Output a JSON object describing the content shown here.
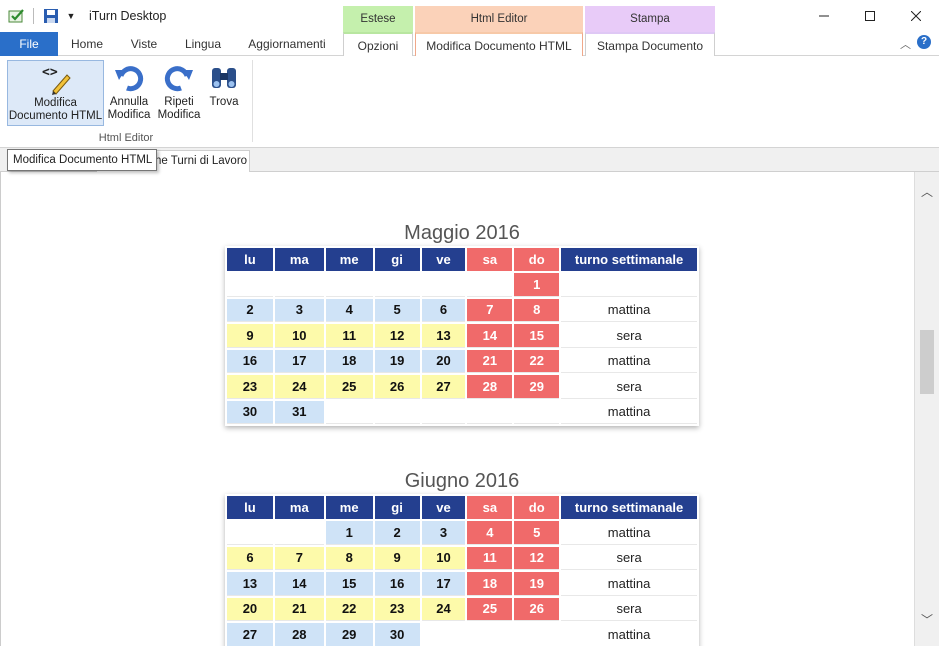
{
  "app": {
    "title": "iTurn Desktop"
  },
  "quick_access": {
    "icons": [
      "app-check-icon",
      "save-icon",
      "dropdown-icon"
    ]
  },
  "contextual": {
    "estese": "Estese",
    "html_editor": "Html Editor",
    "stampa": "Stampa"
  },
  "tabs": {
    "file": "File",
    "home": "Home",
    "viste": "Viste",
    "lingua": "Lingua",
    "aggiornamenti": "Aggiornamenti",
    "opzioni": "Opzioni",
    "modifica_doc": "Modifica Documento HTML",
    "stampa_doc": "Stampa Documento"
  },
  "ribbon": {
    "modifica_l1": "Modifica",
    "modifica_l2": "Documento HTML",
    "annulla_l1": "Annulla",
    "annulla_l2": "Modifica",
    "ripeti_l1": "Ripeti",
    "ripeti_l2": "Modifica",
    "trova": "Trova",
    "group_label": "Html Editor"
  },
  "tooltip": "Modifica Documento HTML",
  "doc_tab": "Generazione Turni di Lavoro",
  "doc_tab_visible": "ne Turni di Lavoro",
  "colors": {
    "header": "#243f8f",
    "weekend": "#f06a6a",
    "week_blue": "#cfe3f7",
    "week_yellow": "#fdfaaa",
    "file_tab": "#2a6fc9"
  },
  "calendar": {
    "headers": [
      "lu",
      "ma",
      "me",
      "gi",
      "ve",
      "sa",
      "do",
      "turno settimanale"
    ],
    "months": [
      {
        "title": "Maggio 2016",
        "rows": [
          {
            "days": [
              "",
              "",
              "",
              "",
              "",
              "",
              "1"
            ],
            "turno": "",
            "tint": "b"
          },
          {
            "days": [
              "2",
              "3",
              "4",
              "5",
              "6",
              "7",
              "8"
            ],
            "turno": "mattina",
            "tint": "b"
          },
          {
            "days": [
              "9",
              "10",
              "11",
              "12",
              "13",
              "14",
              "15"
            ],
            "turno": "sera",
            "tint": "y"
          },
          {
            "days": [
              "16",
              "17",
              "18",
              "19",
              "20",
              "21",
              "22"
            ],
            "turno": "mattina",
            "tint": "b"
          },
          {
            "days": [
              "23",
              "24",
              "25",
              "26",
              "27",
              "28",
              "29"
            ],
            "turno": "sera",
            "tint": "y"
          },
          {
            "days": [
              "30",
              "31",
              "",
              "",
              "",
              "",
              ""
            ],
            "turno": "mattina",
            "tint": "b"
          }
        ]
      },
      {
        "title": "Giugno 2016",
        "rows": [
          {
            "days": [
              "",
              "",
              "1",
              "2",
              "3",
              "4",
              "5"
            ],
            "turno": "mattina",
            "tint": "b"
          },
          {
            "days": [
              "6",
              "7",
              "8",
              "9",
              "10",
              "11",
              "12"
            ],
            "turno": "sera",
            "tint": "y"
          },
          {
            "days": [
              "13",
              "14",
              "15",
              "16",
              "17",
              "18",
              "19"
            ],
            "turno": "mattina",
            "tint": "b"
          },
          {
            "days": [
              "20",
              "21",
              "22",
              "23",
              "24",
              "25",
              "26"
            ],
            "turno": "sera",
            "tint": "y"
          },
          {
            "days": [
              "27",
              "28",
              "29",
              "30",
              "",
              "",
              ""
            ],
            "turno": "mattina",
            "tint": "b"
          }
        ]
      }
    ]
  }
}
